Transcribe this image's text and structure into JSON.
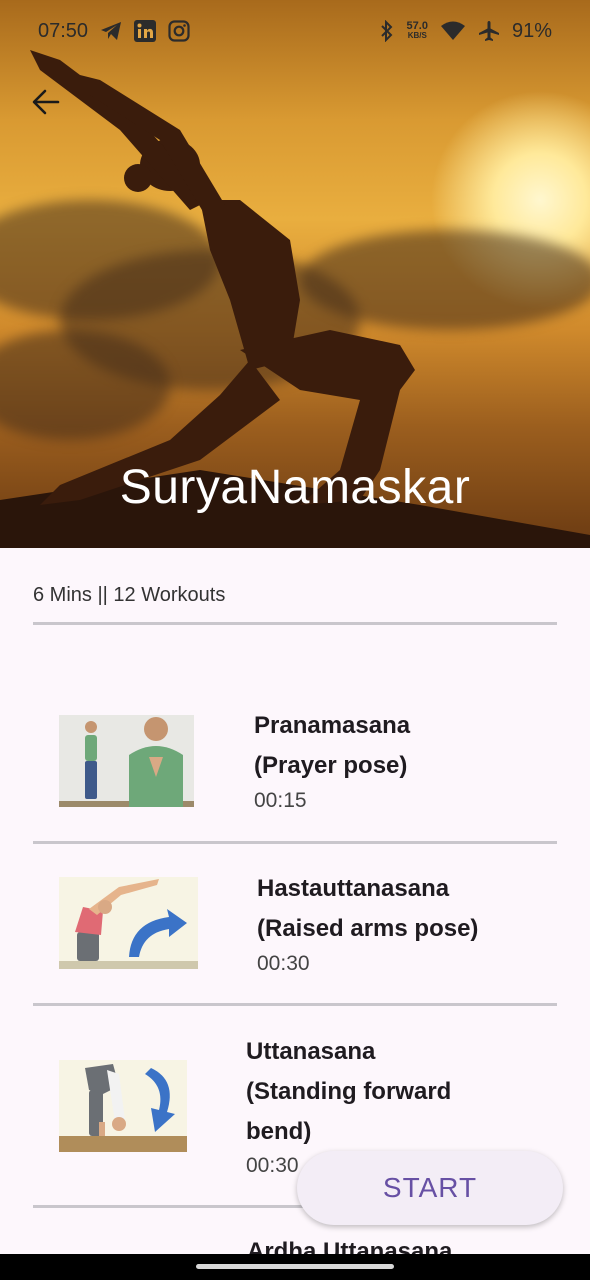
{
  "status_bar": {
    "time": "07:50",
    "speed": "57.0",
    "speed_unit": "KB/S",
    "battery": "91%"
  },
  "hero": {
    "title": "SuryaNamaskar"
  },
  "summary": "6 Mins || 12 Workouts",
  "exercises": [
    {
      "line1": "Pranamasana",
      "line2": "(Prayer pose)",
      "line3": "",
      "time": "00:15"
    },
    {
      "line1": "Hastauttanasana",
      "line2": "(Raised arms pose)",
      "line3": "",
      "time": "00:30"
    },
    {
      "line1": "Uttanasana",
      "line2": "(Standing forward",
      "line3": "bend)",
      "time": "00:30"
    }
  ],
  "next_exercise_peek": "Ardha Uttanasana",
  "start_button": "START",
  "colors": {
    "accent": "#6750a4",
    "background": "#fdf7fc",
    "divider": "#c9c6cc"
  }
}
